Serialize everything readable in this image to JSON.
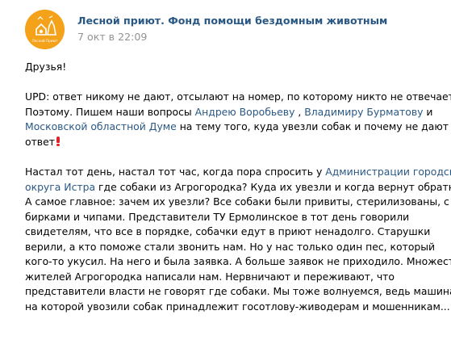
{
  "post": {
    "author": "Лесной приют. Фонд помощи бездомным животным",
    "date": "7 окт в 22:09",
    "avatar_label": "Лесной Приют",
    "greeting": "Друзья!",
    "upd": {
      "l1": "UPD: ответ никому не дают, отсылают на номер, по которому никто не отвечает.",
      "l2_pre": "Поэтому. Пишем наши вопросы ",
      "l2_link1": "Андрею Воробьеву",
      "l2_mid1": " , ",
      "l2_link2": "Владимиру Бурматову",
      "l2_post": " и",
      "l3_link": "Московской областной Думе",
      "l3_post": " на тему того, куда увезли собак и почему не дают",
      "l4": "ответ"
    },
    "body": {
      "l1_pre": "Настал тот день, настал тот час, когда пора спросить у ",
      "l1_link": "Администрации городского",
      "l2_link": "округа Истра",
      "l2_post": " где собаки из Агрогородка? Куда их увезли и когда вернут обратно?",
      "l3": "А самое главное: зачем их увезли? Все собаки были привиты, стерилизованы, с",
      "l4": "бирками и чипами. Представители ТУ Ермолинское в тот день говорили",
      "l5": "свидетелям, что все в порядке, собачки едут в приют ненадолго. Старушки",
      "l6": "верили, а кто поможе стали звонить нам. Но у нас только один пес, который",
      "l7": "кого-то укусил. На него и была заявка. А больше заявок не приходило. Множество",
      "l8": "жителей Агрогородка написали нам. Нервничают и переживают, что",
      "l9": "представители власти не говорят где собаки. Мы тоже волнуемся, ведь машина,",
      "l10": "на которой увозили собак принадлежит госотлову-живодерам и мошенникам..."
    },
    "colors": {
      "link": "#2a5885",
      "meta": "#939393",
      "avatar_bg": "#f4a21a",
      "emoji_red": "#e0242d"
    },
    "icons": {
      "avatar": "shelter-logo-icon",
      "emoji": "red-exclamation-icon"
    }
  }
}
